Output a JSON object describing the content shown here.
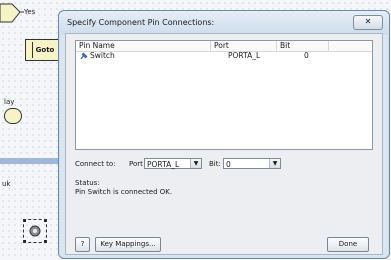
{
  "canvas": {
    "yes_label": "Yes",
    "goto_label": "Goto",
    "delay_label": "lay",
    "side_label": "uk"
  },
  "dialog": {
    "title": "Specify Component Pin Connections:",
    "close_label": "✕",
    "columns": [
      "Pin Name",
      "Port",
      "Bit"
    ],
    "rows": [
      {
        "pin_name": "Switch",
        "port": "PORTA_L",
        "bit": "0"
      }
    ],
    "connect_to_label": "Connect to:",
    "port_label": "Port",
    "port_value": "PORTA_L",
    "bit_label": "Bit:",
    "bit_value": "0",
    "status_label": "Status:",
    "status_text": "Pin Switch is connected OK.",
    "help_label": "?",
    "key_mappings_label": "Key Mappings...",
    "done_label": "Done"
  },
  "colors": {
    "dialog_bg": "#dbe5ef",
    "panel_bg": "#eceef2",
    "flow_shape_fill": "#f6f3c7"
  },
  "icons": {
    "pin": "pin-icon",
    "dropdown": "chevron-down-icon",
    "component": "component-icon"
  }
}
